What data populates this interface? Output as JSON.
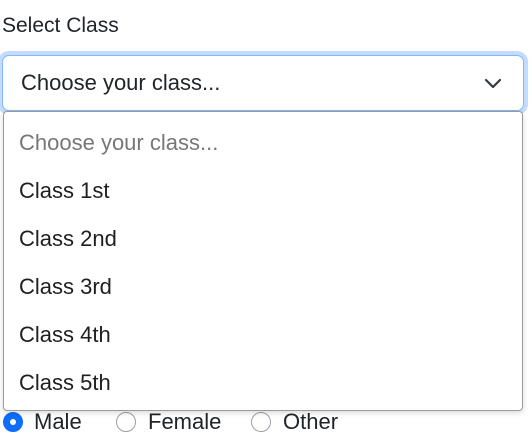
{
  "form": {
    "class_label": "Select Class",
    "class_select": {
      "selected": "Choose your class...",
      "options": [
        "Choose your class...",
        "Class 1st",
        "Class 2nd",
        "Class 3rd",
        "Class 4th",
        "Class 5th"
      ]
    },
    "gender": {
      "options": [
        "Male",
        "Female",
        "Other"
      ],
      "checked": "Male"
    }
  },
  "colors": {
    "focus_border": "#86b7fe",
    "radio_checked": "#0d6efd",
    "placeholder_text": "#777777"
  }
}
